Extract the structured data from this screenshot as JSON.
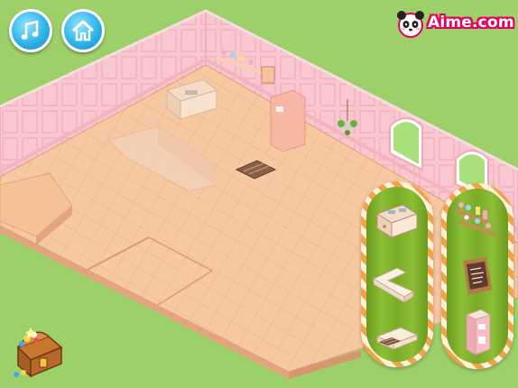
{
  "title_bar": {
    "logo_text": "Aime.com"
  },
  "controls": {
    "music_icon": "music-note-icon",
    "home_icon": "house-icon",
    "chest_icon": "treasure-chest-icon"
  },
  "palette": {
    "lawn": "#9ed06a",
    "floor": "#f7c9a2",
    "wall": "#f9c7cf",
    "button_blue": "#2fb4ea",
    "logo_pink": "#e5005f",
    "shelf_green": "#7aab28",
    "shelf_stripe": "#f4a24a"
  },
  "furniture_panel_left": {
    "items": [
      "kitchen-sink-counter-icon",
      "l-shaped-counter-icon",
      "floor-step-icon"
    ]
  },
  "furniture_panel_right": {
    "items": [
      "wall-shelf-icon",
      "chalkboard-icon",
      "pink-fridge-icon"
    ]
  }
}
